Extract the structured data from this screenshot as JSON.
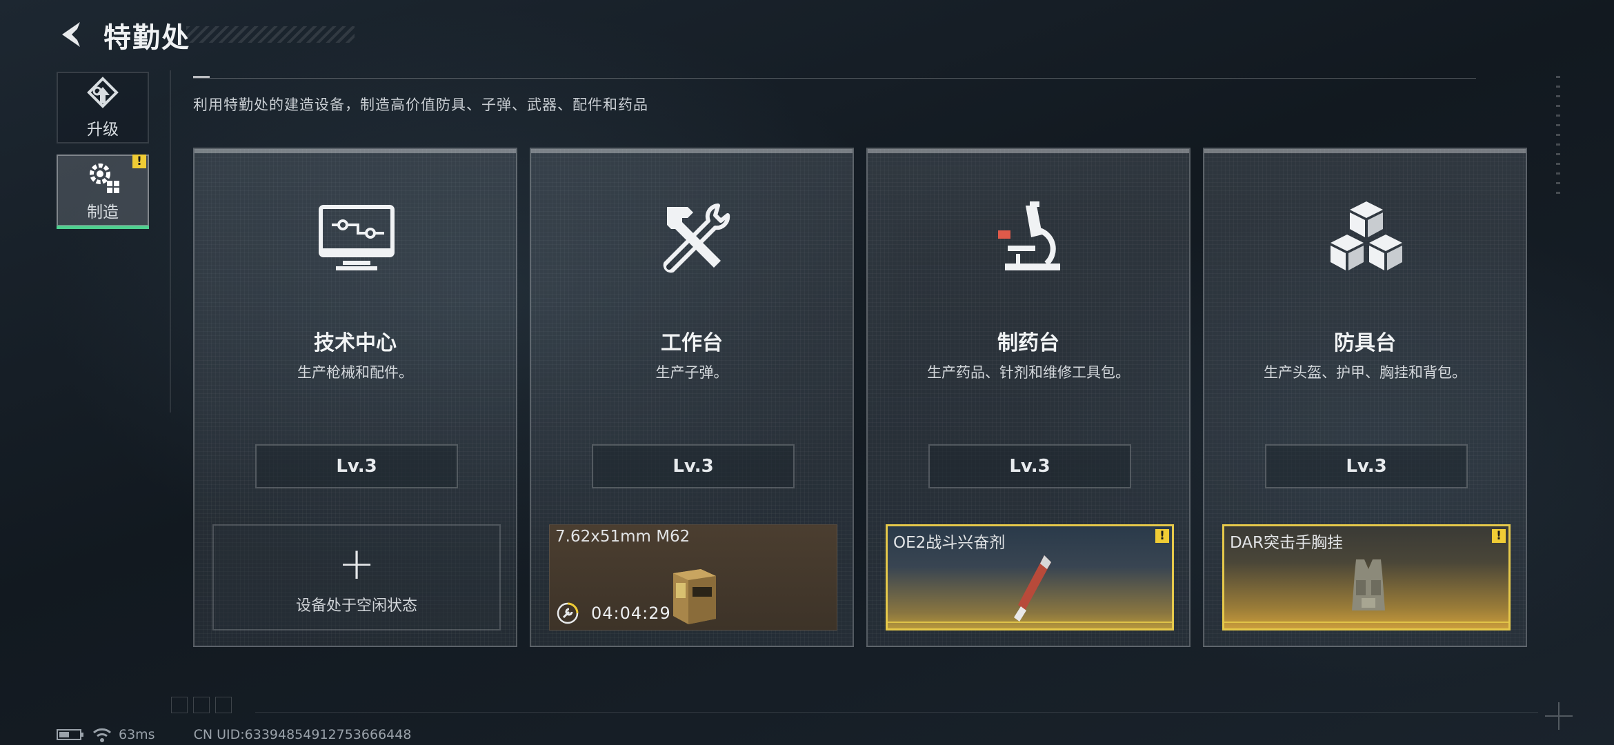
{
  "header": {
    "title": "特勤处"
  },
  "sidebar": {
    "items": [
      {
        "label": "升级",
        "icon": "upgrade-arrow-icon",
        "active": false
      },
      {
        "label": "制造",
        "icon": "gear-blocks-icon",
        "active": true,
        "badge": "!"
      }
    ]
  },
  "description": "利用特勤处的建造设备，制造高价值防具、子弹、武器、配件和药品",
  "stations": [
    {
      "name": "技术中心",
      "desc": "生产枪械和配件。",
      "level": "Lv.3",
      "icon": "monitor-circuit-icon",
      "slot": {
        "state": "idle",
        "plus": "+",
        "text": "设备处于空闲状态"
      }
    },
    {
      "name": "工作台",
      "desc": "生产子弹。",
      "level": "Lv.3",
      "icon": "hammer-wrench-icon",
      "slot": {
        "state": "producing",
        "item": "7.62x51mm M62",
        "timer": "04:04:29"
      }
    },
    {
      "name": "制药台",
      "desc": "生产药品、针剂和维修工具包。",
      "level": "Lv.3",
      "icon": "microscope-icon",
      "slot": {
        "state": "ready",
        "item": "OE2战斗兴奋剂",
        "badge": "!"
      }
    },
    {
      "name": "防具台",
      "desc": "生产头盔、护甲、胸挂和背包。",
      "level": "Lv.3",
      "icon": "cubes-icon",
      "slot": {
        "state": "ready",
        "item": "DAR突击手胸挂",
        "badge": "!"
      }
    }
  ],
  "status": {
    "ping": "63ms",
    "uid": "CN UID:6339485491275366​6448"
  },
  "colors": {
    "accent_green": "#4ed08f",
    "warn_yellow": "#f0cc35",
    "gold_border": "#e6c94a"
  }
}
